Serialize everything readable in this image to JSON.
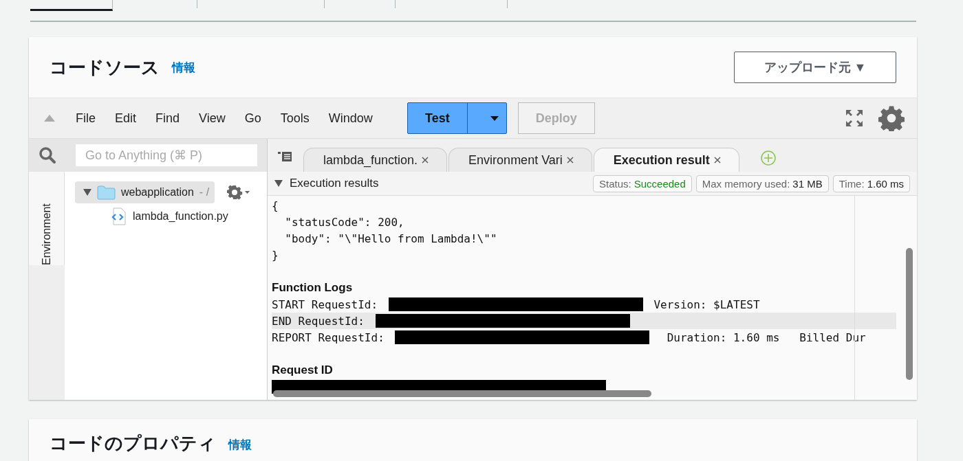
{
  "top_tabs": [
    {
      "selected": true
    },
    {
      "selected": false
    },
    {
      "selected": false
    },
    {
      "selected": false
    },
    {
      "selected": false
    }
  ],
  "code_source": {
    "title": "コードソース",
    "info_link": "情報",
    "upload_button": "アップロード元 ▼"
  },
  "ide": {
    "menu": [
      "File",
      "Edit",
      "Find",
      "View",
      "Go",
      "Tools",
      "Window"
    ],
    "test_button": {
      "label": "Test",
      "disabled": false
    },
    "deploy_button": {
      "label": "Deploy",
      "disabled": true
    },
    "search": {
      "placeholder": "Go to Anything (⌘ P)"
    },
    "side_tab": "Environment",
    "tree": [
      {
        "name": "webapplication",
        "suffix": "- /",
        "expanded": true,
        "children": [
          {
            "name": "lambda_function.py"
          }
        ]
      }
    ],
    "editor_tabs": [
      {
        "label": "lambda_function.",
        "selected": false
      },
      {
        "label": "Environment Vari",
        "selected": false
      },
      {
        "label": "Execution result",
        "selected": true
      }
    ],
    "results": {
      "title": "Execution results",
      "expanded": true,
      "chips": [
        {
          "kind": "status",
          "label": "Status:",
          "value": "Succeeded"
        },
        {
          "kind": "plain",
          "label": "Max memory used:",
          "value": "31 MB"
        },
        {
          "kind": "plain",
          "label": "Time:",
          "value": "1.60 ms"
        }
      ],
      "lines": [
        {
          "kind": "code",
          "highlighted": false,
          "parts": [
            {
              "kind": "text",
              "text": "{"
            }
          ]
        },
        {
          "kind": "code",
          "highlighted": false,
          "parts": [
            {
              "kind": "text",
              "text": "  \"statusCode\": 200,"
            }
          ]
        },
        {
          "kind": "code",
          "highlighted": false,
          "parts": [
            {
              "kind": "text",
              "text": "  \"body\": \"\\\"Hello from Lambda!\\\"\""
            }
          ]
        },
        {
          "kind": "code",
          "highlighted": false,
          "parts": [
            {
              "kind": "text",
              "text": "}"
            }
          ]
        },
        {
          "kind": "blank",
          "highlighted": false
        },
        {
          "kind": "heading",
          "highlighted": false,
          "text": "Function Logs"
        },
        {
          "kind": "code",
          "highlighted": false,
          "parts": [
            {
              "kind": "text",
              "text": "START RequestId: "
            },
            {
              "kind": "redaction"
            },
            {
              "kind": "text",
              "text": " Version: $LATEST"
            }
          ]
        },
        {
          "kind": "code",
          "highlighted": true,
          "parts": [
            {
              "kind": "text",
              "text": "END RequestId: "
            },
            {
              "kind": "redaction"
            }
          ]
        },
        {
          "kind": "code",
          "highlighted": false,
          "parts": [
            {
              "kind": "text",
              "text": "REPORT RequestId: "
            },
            {
              "kind": "redaction"
            },
            {
              "kind": "text",
              "text": "  Duration: 1.60 ms   Billed Dur"
            }
          ]
        },
        {
          "kind": "blank",
          "highlighted": false
        },
        {
          "kind": "heading",
          "highlighted": false,
          "text": "Request ID"
        },
        {
          "kind": "code",
          "highlighted": false,
          "parts": [
            {
              "kind": "redaction"
            }
          ]
        }
      ]
    }
  },
  "code_properties": {
    "title": "コードのプロパティ",
    "info_link": "情報"
  }
}
